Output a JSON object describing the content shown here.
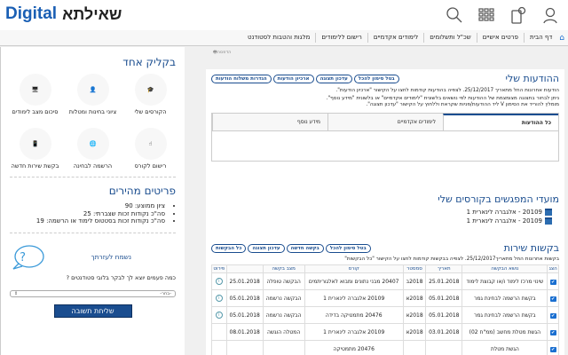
{
  "header": {
    "logo_en": "Digital",
    "logo_he": "שאילתא",
    "icons": [
      "user-icon",
      "tablet-chat-icon",
      "apps-grid-icon",
      "search-icon"
    ]
  },
  "nav": [
    "דף הבית",
    "פרטים אישיים",
    "שכ\"ל ותשלומים",
    "לימודים אקדמיים",
    "רישום ללימודים",
    "מלגות והטבות לסטודנט"
  ],
  "print_label": "הדפסה",
  "sidebar": {
    "quick_title": "בקליק אחד",
    "quick": [
      {
        "label": "הקורסים שלי",
        "icon": "my-courses-icon"
      },
      {
        "label": "ציוני בחינות ומטלות",
        "icon": "grades-icon"
      },
      {
        "label": "סיכום מצב לימודים",
        "icon": "study-summary-icon"
      },
      {
        "label": "רישום לקורס",
        "icon": "course-registration-icon"
      },
      {
        "label": "הרשמה לבחינה",
        "icon": "exam-registration-icon"
      },
      {
        "label": "בקשת שירות חדשה",
        "icon": "new-service-request-icon"
      }
    ],
    "facts_title": "פריטים מהירים",
    "facts": [
      "ציון ממוצע: 90",
      "סה\"כ נקודות זכות שצברתי: 25",
      "סה\"כ נקודות זכות בסטטוס לימוד או הרשמה: 19"
    ],
    "help_title": "נשמח לעזרתך",
    "question": "כמה פעמים יוצא לך לבקר בלובי סטודנטים ?",
    "select_value": "-בחר-",
    "send": "שליחת תשובה"
  },
  "messages": {
    "title": "ההודעות שלי",
    "buttons": [
      "בטל סימון להכל",
      "עדכון תצוגה",
      "ארכיון הודעות",
      "הגדרות משלוח הודעות"
    ],
    "p1": "הודעות אחרונות החל מתאריך 25/12/2017. לצפיה בהודעות קודמות לחצו על הקישור \"ארכיון הודעות\".",
    "p2": "ניתן לבחור בתצוגה מצומצמת של ההודעות לפי נושאים בלשונית \"לימודים אקדמיים\" או בלשונית \"מידע נוסף\".",
    "p3": "מומלץ להוריד את הסימון V ליד ההודעות/פניות שקראת וללחוץ על הקישור \"עדכון תצוגה\".",
    "tabs": [
      "כל ההודעות",
      "לימודים אקדמיים",
      "מידע נוסף"
    ]
  },
  "meetings": {
    "title": "מועדי המפגשים בקורסים שלי",
    "items": [
      "20109 - אלגברה לינארית 1",
      "20109 - אלגברה לינארית 1"
    ]
  },
  "requests": {
    "title": "בקשות שירות",
    "buttons": [
      "בטל סימון להכל",
      "בקשה חדשה",
      "עדכון תצוגה",
      "כל הבקשות"
    ],
    "note": "בקשות אחרונות החל מתאריך25/12/2017. לצפיה בבקשות קודמות לחצו על הקישור \"כל הבקשות\"",
    "columns": [
      "הצג",
      "נושא הבקשה",
      "תאריך",
      "סמסטר",
      "קורס",
      "מצב בקשה",
      "",
      "פירוט"
    ],
    "rows": [
      {
        "subject": "שינוי מרכז לימוד ו/או קבוצת לימוד",
        "date": "25.01.2018",
        "sem": "2018ב",
        "course": "20407 מבני נתונים ומבוא לאלגוריתמים",
        "status": "הבקשה טופלה",
        "sdate": "25.01.2018",
        "info": true
      },
      {
        "subject": "בקשת הרשמה לבחינת גמר",
        "date": "05.01.2018",
        "sem": "2018א",
        "course": "20109 אלגברה לינארית 1",
        "status": "הבקשה נרשמה",
        "sdate": "05.01.2018",
        "info": true
      },
      {
        "subject": "בקשת הרשמה לבחינת גמר",
        "date": "05.01.2018",
        "sem": "2018א",
        "course": "20476 מתמטיקה בדידה",
        "status": "הבקשה נרשמה",
        "sdate": "05.01.2018",
        "info": true
      },
      {
        "subject": "הגשת מטלת מחשב (ממ\"ח 02)",
        "date": "03.01.2018",
        "sem": "2018א",
        "course": "20109 אלגברה לינארית 1",
        "status": "המטלה הוגשה",
        "sdate": "08.01.2018",
        "info": false
      },
      {
        "subject": "הגשת מטלת",
        "date": "",
        "sem": "",
        "course": "20476 מתמטיקה",
        "status": "",
        "sdate": "",
        "info": false
      }
    ]
  }
}
